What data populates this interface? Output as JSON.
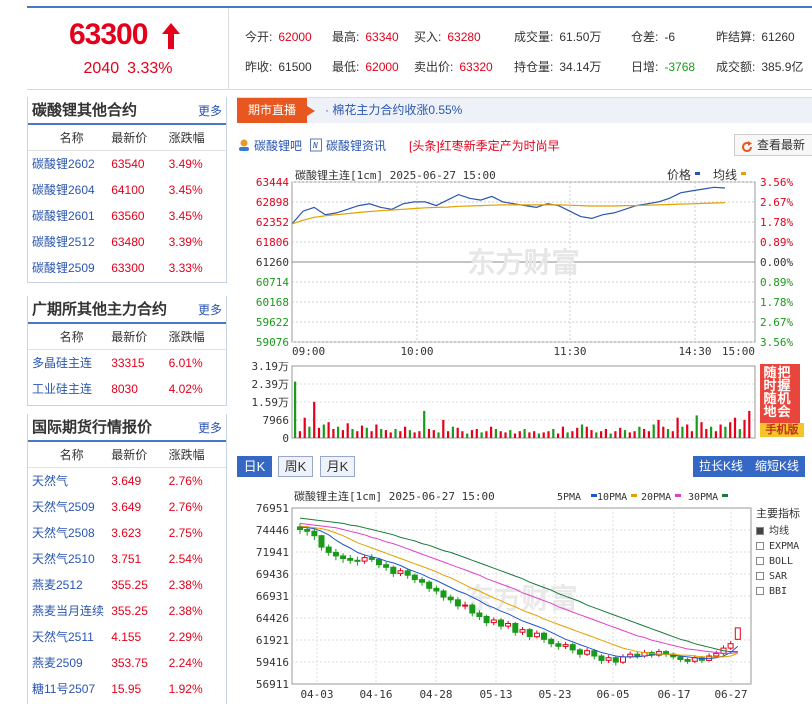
{
  "quote": {
    "price": "63300",
    "change": "2040",
    "change_pct": "3.33%",
    "fields": [
      {
        "k": "今开:",
        "v": "62000",
        "c": "red"
      },
      {
        "k": "最高:",
        "v": "63340",
        "c": "red"
      },
      {
        "k": "买入:",
        "v": "63280",
        "c": "red"
      },
      {
        "k": "成交量:",
        "v": "61.50万",
        "c": "dark"
      },
      {
        "k": "仓差:",
        "v": "-6",
        "c": "dark"
      },
      {
        "k": "昨结算:",
        "v": "61260",
        "c": "dark"
      },
      {
        "k": "昨收:",
        "v": "61500",
        "c": "dark"
      },
      {
        "k": "最低:",
        "v": "62000",
        "c": "red"
      },
      {
        "k": "卖出价:",
        "v": "63320",
        "c": "red"
      },
      {
        "k": "持仓量:",
        "v": "34.14万",
        "c": "dark"
      },
      {
        "k": "日增:",
        "v": "-3768",
        "c": "green"
      },
      {
        "k": "成交额:",
        "v": "385.9亿",
        "c": "dark"
      }
    ]
  },
  "panels": [
    {
      "title": "碳酸锂其他合约",
      "more": "更多",
      "head": [
        "名称",
        "最新价",
        "涨跌幅"
      ],
      "rows": [
        [
          "碳酸锂2602",
          "63540",
          "3.49%"
        ],
        [
          "碳酸锂2604",
          "64100",
          "3.45%"
        ],
        [
          "碳酸锂2601",
          "63560",
          "3.45%"
        ],
        [
          "碳酸锂2512",
          "63480",
          "3.39%"
        ],
        [
          "碳酸锂2509",
          "63300",
          "3.33%"
        ]
      ]
    },
    {
      "title": "广期所其他主力合约",
      "more": "更多",
      "head": [
        "名称",
        "最新价",
        "涨跌幅"
      ],
      "rows": [
        [
          "多晶硅主连",
          "33315",
          "6.01%"
        ],
        [
          "工业硅主连",
          "8030",
          "4.02%"
        ]
      ]
    },
    {
      "title": "国际期货行情报价",
      "more": "更多",
      "head": [
        "名称",
        "最新价",
        "涨跌幅"
      ],
      "rows": [
        [
          "天然气",
          "3.649",
          "2.76%"
        ],
        [
          "天然气2509",
          "3.649",
          "2.76%"
        ],
        [
          "天然气2508",
          "3.623",
          "2.75%"
        ],
        [
          "天然气2510",
          "3.751",
          "2.54%"
        ],
        [
          "燕麦2512",
          "355.25",
          "2.38%"
        ],
        [
          "燕麦当月连续",
          "355.25",
          "2.38%"
        ],
        [
          "天然气2511",
          "4.155",
          "2.29%"
        ],
        [
          "燕麦2509",
          "353.75",
          "2.24%"
        ],
        [
          "糖11号2507",
          "15.95",
          "1.92%"
        ]
      ]
    }
  ],
  "live": {
    "tag": "期市直播",
    "text": "· 棉花主力合约收涨0.55%"
  },
  "links": {
    "bar": "碳酸锂吧",
    "news": "碳酸锂资讯",
    "headline": "[头条]红枣新季定产为时尚早",
    "refresh": "查看最新"
  },
  "tabs": {
    "day": "日K",
    "week": "周K",
    "month": "月K",
    "stretch": "拉长K线",
    "shrink": "缩短K线"
  },
  "indicators": {
    "title": "主要指标",
    "items": [
      "均线",
      "EXPMA",
      "BOLL",
      "SAR",
      "BBI"
    ],
    "selected": 0
  },
  "ad": {
    "text": "把握机会随时随地",
    "tag": "手机版"
  },
  "watermark": "东方财富",
  "colors": {
    "up": "#e4001b",
    "down": "#1a9a1a",
    "price_line": "#2a56b0",
    "avg_line": "#e3a100",
    "ma5": "#2255cc",
    "ma10": "#e3a100",
    "ma20": "#e040c8",
    "ma30": "#1a7a3a"
  },
  "chart_data": [
    {
      "type": "line",
      "title": "碳酸锂主连[1cm] 2025-06-27 15:00",
      "legend": [
        "价格",
        "均线"
      ],
      "x_ticks": [
        "09:00",
        "10:00",
        "11:30",
        "14:30",
        "15:00"
      ],
      "y_left_ticks": [
        "63444",
        "62898",
        "62352",
        "61806",
        "61260",
        "60714",
        "60168",
        "59622",
        "59076"
      ],
      "y_right_ticks": [
        "3.56%",
        "2.67%",
        "1.78%",
        "0.89%",
        "0.00%",
        "0.89%",
        "1.78%",
        "2.67%",
        "3.56%"
      ],
      "ylim": [
        59076,
        63444
      ],
      "series": [
        {
          "name": "价格",
          "values": [
            62300,
            62650,
            62750,
            62550,
            62600,
            62700,
            62800,
            62850,
            62750,
            62700,
            62850,
            62900,
            62900,
            62800,
            62950,
            63100,
            63000,
            62950,
            63050,
            62900,
            62850,
            62800,
            62750,
            62850,
            62800,
            62650,
            62500,
            62450,
            62550,
            62600,
            62700,
            62800,
            62850,
            62900,
            63000,
            63150,
            63200,
            63250,
            63300,
            63280
          ]
        },
        {
          "name": "均线",
          "values": [
            62300,
            62400,
            62480,
            62520,
            62550,
            62580,
            62610,
            62640,
            62660,
            62680,
            62700,
            62720,
            62740,
            62750,
            62760,
            62780,
            62790,
            62800,
            62810,
            62820,
            62820,
            62820,
            62820,
            62820,
            62820,
            62810,
            62800,
            62790,
            62790,
            62790,
            62800,
            62800,
            62810,
            62820,
            62830,
            62840,
            62850,
            62860,
            62870,
            62880
          ]
        }
      ]
    },
    {
      "type": "bar",
      "title": "",
      "y_ticks": [
        "3.19万",
        "2.39万",
        "1.59万",
        "7966",
        "0"
      ],
      "ylim": [
        0,
        31900
      ],
      "values": [
        25000,
        3000,
        9000,
        5000,
        16000,
        4500,
        6000,
        7000,
        4000,
        5000,
        3500,
        6500,
        4000,
        3000,
        5500,
        4500,
        3000,
        6000,
        4000,
        3500,
        2500,
        4000,
        3000,
        5000,
        3500,
        2500,
        3000,
        12000,
        4000,
        3500,
        2500,
        8000,
        3000,
        5000,
        4500,
        3000,
        2000,
        3500,
        4000,
        2500,
        3000,
        5000,
        4000,
        3000,
        2500,
        3500,
        2000,
        3000,
        4000,
        2500,
        3000,
        2000,
        2500,
        3000,
        4000,
        2000,
        5000,
        2500,
        3000,
        4500,
        6000,
        5000,
        3500,
        2500,
        3000,
        4000,
        2000,
        3000,
        4500,
        3500,
        2500,
        3000,
        5000,
        4000,
        3000,
        6000,
        8000,
        5000,
        4000,
        3000,
        9000,
        5000,
        6000,
        3000,
        10000,
        7000,
        4000,
        5000,
        3000,
        6000,
        5000,
        7000,
        9000,
        4000,
        8000,
        12000
      ]
    },
    {
      "type": "candlestick",
      "title": "碳酸锂主连[1cm] 2025-06-27 15:00",
      "legend": [
        "5PMA",
        "10PMA",
        "20PMA",
        "30PMA"
      ],
      "x_ticks": [
        "04-03",
        "04-16",
        "04-28",
        "05-13",
        "05-23",
        "06-05",
        "06-17",
        "06-27"
      ],
      "y_ticks": [
        "76951",
        "74446",
        "71941",
        "69436",
        "66931",
        "64426",
        "61921",
        "59416",
        "56911"
      ],
      "ylim": [
        56911,
        76951
      ],
      "candles": [
        [
          74800,
          74500,
          75200,
          74000
        ],
        [
          74500,
          74300,
          74900,
          73800
        ],
        [
          74300,
          73800,
          74600,
          73300
        ],
        [
          73800,
          72500,
          73900,
          72100
        ],
        [
          72500,
          71900,
          72800,
          71500
        ],
        [
          71900,
          71500,
          72300,
          71000
        ],
        [
          71500,
          71200,
          71800,
          70700
        ],
        [
          71200,
          71000,
          71600,
          70600
        ],
        [
          71000,
          70900,
          71400,
          70400
        ],
        [
          70900,
          71300,
          71600,
          70600
        ],
        [
          71300,
          71100,
          71700,
          70800
        ],
        [
          71100,
          70500,
          71300,
          70100
        ],
        [
          70500,
          70200,
          70800,
          69800
        ],
        [
          70200,
          69500,
          70400,
          69100
        ],
        [
          69500,
          69800,
          70100,
          69200
        ],
        [
          69800,
          69300,
          70000,
          68900
        ],
        [
          69300,
          68800,
          69500,
          68400
        ],
        [
          68800,
          68500,
          69100,
          68100
        ],
        [
          68500,
          67800,
          68700,
          67400
        ],
        [
          67800,
          67500,
          68100,
          67100
        ],
        [
          67500,
          66800,
          67700,
          66400
        ],
        [
          66800,
          66500,
          67100,
          66100
        ],
        [
          66500,
          65800,
          66800,
          65400
        ],
        [
          65800,
          65900,
          66300,
          65400
        ],
        [
          65900,
          65000,
          66100,
          64600
        ],
        [
          65000,
          64600,
          65300,
          64200
        ],
        [
          64600,
          63900,
          64800,
          63500
        ],
        [
          63900,
          64200,
          64500,
          63600
        ],
        [
          64200,
          63500,
          64400,
          63100
        ],
        [
          63500,
          63800,
          64100,
          63200
        ],
        [
          63800,
          62800,
          64000,
          62400
        ],
        [
          62800,
          63100,
          63400,
          62500
        ],
        [
          63100,
          62300,
          63300,
          61900
        ],
        [
          62300,
          62700,
          63000,
          62100
        ],
        [
          62700,
          62000,
          62900,
          61600
        ],
        [
          62000,
          61500,
          62200,
          61100
        ],
        [
          61500,
          61200,
          61800,
          60800
        ],
        [
          61200,
          61400,
          61700,
          60900
        ],
        [
          61400,
          60800,
          61600,
          60400
        ],
        [
          60800,
          60300,
          61000,
          59900
        ],
        [
          60300,
          60700,
          61000,
          60100
        ],
        [
          60700,
          60100,
          60900,
          59700
        ],
        [
          60100,
          59600,
          60300,
          59200
        ],
        [
          59600,
          59900,
          60200,
          59300
        ],
        [
          59900,
          59400,
          60100,
          59000
        ],
        [
          59400,
          60000,
          60300,
          59200
        ],
        [
          60000,
          60300,
          60600,
          59800
        ],
        [
          60300,
          60100,
          60600,
          59800
        ],
        [
          60100,
          60500,
          60800,
          59900
        ],
        [
          60500,
          60200,
          60700,
          59900
        ],
        [
          60200,
          60600,
          60900,
          60000
        ],
        [
          60600,
          60300,
          60800,
          60000
        ],
        [
          60300,
          60000,
          60500,
          59700
        ],
        [
          60000,
          59700,
          60200,
          59400
        ],
        [
          59700,
          59500,
          59900,
          59200
        ],
        [
          59500,
          59900,
          60200,
          59300
        ],
        [
          59900,
          59600,
          60100,
          59300
        ],
        [
          59600,
          60100,
          60400,
          59500
        ],
        [
          60100,
          60400,
          60700,
          59900
        ],
        [
          60400,
          61000,
          61300,
          60200
        ],
        [
          61000,
          61500,
          61800,
          60800
        ],
        [
          62000,
          63300,
          63340,
          62000
        ]
      ],
      "series": [
        {
          "name": "5PMA",
          "values": [
            74800,
            74700,
            74600,
            74300,
            73900,
            73300,
            72800,
            72400,
            71900,
            71600,
            71400,
            71200,
            70900,
            70700,
            70400,
            70000,
            69700,
            69400,
            69000,
            68700,
            68300,
            67900,
            67500,
            67200,
            66800,
            66400,
            65900,
            65600,
            65200,
            64900,
            64500,
            64100,
            63800,
            63500,
            63200,
            62800,
            62400,
            62000,
            61700,
            61400,
            61100,
            60800,
            60500,
            60300,
            60100,
            60000,
            60000,
            60000,
            60100,
            60200,
            60300,
            60300,
            60200,
            60100,
            60000,
            59900,
            59800,
            59800,
            59900,
            60100,
            60500,
            61200
          ]
        },
        {
          "name": "10PMA",
          "values": [
            74900,
            74800,
            74700,
            74600,
            74400,
            74100,
            73800,
            73400,
            73000,
            72700,
            72400,
            72100,
            71800,
            71500,
            71200,
            70900,
            70600,
            70300,
            70000,
            69700,
            69300,
            69000,
            68600,
            68200,
            67800,
            67500,
            67100,
            66700,
            66400,
            66000,
            65700,
            65300,
            65000,
            64700,
            64300,
            64000,
            63700,
            63400,
            63100,
            62800,
            62500,
            62200,
            61900,
            61600,
            61300,
            61000,
            60800,
            60600,
            60500,
            60400,
            60300,
            60300,
            60300,
            60200,
            60200,
            60100,
            60000,
            60000,
            60000,
            60000,
            60100,
            60400
          ]
        },
        {
          "name": "20PMA",
          "values": [
            75200,
            75100,
            75000,
            74900,
            74800,
            74700,
            74500,
            74300,
            74100,
            73900,
            73600,
            73400,
            73100,
            72900,
            72600,
            72300,
            72000,
            71700,
            71400,
            71100,
            70800,
            70500,
            70200,
            69900,
            69600,
            69300,
            68900,
            68600,
            68300,
            68000,
            67700,
            67300,
            67000,
            66700,
            66400,
            66100,
            65700,
            65400,
            65100,
            64800,
            64500,
            64200,
            63900,
            63600,
            63300,
            63000,
            62700,
            62400,
            62200,
            61900,
            61700,
            61500,
            61300,
            61100,
            60900,
            60800,
            60700,
            60600,
            60500,
            60400,
            60400,
            60500
          ]
        },
        {
          "name": "30PMA",
          "values": [
            75800,
            75700,
            75600,
            75500,
            75400,
            75300,
            75200,
            75000,
            74900,
            74700,
            74500,
            74300,
            74100,
            73900,
            73600,
            73400,
            73200,
            72900,
            72700,
            72400,
            72100,
            71900,
            71600,
            71300,
            71000,
            70700,
            70400,
            70100,
            69800,
            69500,
            69200,
            68900,
            68500,
            68200,
            67900,
            67600,
            67200,
            66900,
            66600,
            66300,
            65900,
            65600,
            65300,
            65000,
            64700,
            64400,
            64100,
            63800,
            63500,
            63200,
            62900,
            62600,
            62300,
            62000,
            61800,
            61500,
            61300,
            61100,
            60900,
            60700,
            60600,
            60600
          ]
        }
      ]
    }
  ]
}
